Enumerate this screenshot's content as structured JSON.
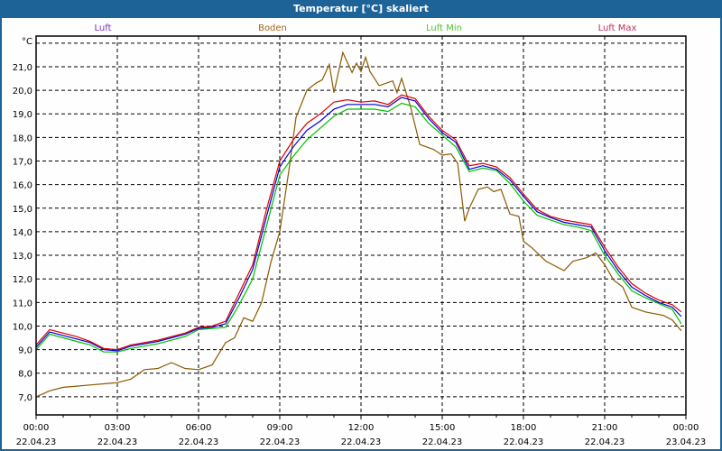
{
  "window": {
    "title": "Temperatur [°C] skaliert"
  },
  "chart_data": {
    "type": "line",
    "title": "Temperatur [°C] skaliert",
    "ylabel": "°C",
    "xlabel": "",
    "ylim": [
      6.23,
      22.3
    ],
    "xlim_hours": [
      0,
      24
    ],
    "grid": true,
    "legend_position": "top",
    "yticks": [
      7,
      8,
      9,
      10,
      11,
      12,
      13,
      14,
      15,
      16,
      17,
      18,
      19,
      20,
      21,
      22
    ],
    "ytick_labels": [
      "7,0",
      "8,0",
      "9,0",
      "10,0",
      "11,0",
      "12,0",
      "13,0",
      "14,0",
      "15,0",
      "16,0",
      "17,0",
      "18,0",
      "19,0",
      "20,0",
      "21,0",
      ""
    ],
    "xticks": [
      {
        "hour": 0,
        "time": "00:00",
        "date": "22.04.23"
      },
      {
        "hour": 3,
        "time": "03:00",
        "date": "22.04.23"
      },
      {
        "hour": 6,
        "time": "06:00",
        "date": "22.04.23"
      },
      {
        "hour": 9,
        "time": "09:00",
        "date": "22.04.23"
      },
      {
        "hour": 12,
        "time": "12:00",
        "date": "22.04.23"
      },
      {
        "hour": 15,
        "time": "15:00",
        "date": "22.04.23"
      },
      {
        "hour": 18,
        "time": "18:00",
        "date": "22.04.23"
      },
      {
        "hour": 21,
        "time": "21:00",
        "date": "22.04.23"
      },
      {
        "hour": 24,
        "time": "00:00",
        "date": "23.04.23"
      }
    ],
    "x_hours": [
      0,
      0.5,
      1,
      1.5,
      2,
      2.5,
      3,
      3.5,
      4,
      4.5,
      5,
      5.5,
      6,
      6.5,
      7,
      7.5,
      8,
      8.5,
      9,
      9.5,
      10,
      10.5,
      11,
      11.5,
      12,
      12.5,
      13,
      13.5,
      14,
      14.5,
      15,
      15.5,
      16,
      16.5,
      17,
      17.5,
      18,
      18.5,
      19,
      19.5,
      20,
      20.5,
      21,
      21.5,
      22,
      22.5,
      23,
      23.5,
      23.83
    ],
    "series": [
      {
        "name": "Luft",
        "color": "#0000e0",
        "values": [
          9.1,
          9.75,
          9.6,
          9.45,
          9.3,
          9.0,
          8.95,
          9.15,
          9.25,
          9.35,
          9.5,
          9.65,
          9.9,
          9.95,
          10.1,
          11.2,
          12.4,
          14.6,
          16.75,
          17.6,
          18.3,
          18.7,
          19.2,
          19.4,
          19.4,
          19.4,
          19.3,
          19.7,
          19.55,
          18.8,
          18.2,
          17.8,
          16.65,
          16.8,
          16.65,
          16.2,
          15.5,
          14.85,
          14.6,
          14.4,
          14.3,
          14.2,
          13.2,
          12.35,
          11.65,
          11.3,
          11.0,
          10.8,
          10.4
        ]
      },
      {
        "name": "Luft Min",
        "color": "#00c000",
        "values": [
          9.0,
          9.65,
          9.5,
          9.35,
          9.2,
          8.9,
          8.9,
          9.05,
          9.15,
          9.25,
          9.4,
          9.55,
          9.85,
          9.9,
          9.95,
          10.9,
          12.0,
          14.2,
          16.4,
          17.2,
          17.9,
          18.4,
          18.9,
          19.2,
          19.2,
          19.2,
          19.1,
          19.45,
          19.3,
          18.6,
          18.1,
          17.6,
          16.55,
          16.7,
          16.6,
          16.05,
          15.3,
          14.7,
          14.5,
          14.3,
          14.2,
          14.05,
          13.0,
          12.2,
          11.5,
          11.2,
          10.95,
          10.7,
          10.1
        ]
      },
      {
        "name": "Luft Max",
        "color": "#e00000",
        "values": [
          9.2,
          9.85,
          9.7,
          9.55,
          9.35,
          9.05,
          9.0,
          9.2,
          9.3,
          9.4,
          9.55,
          9.7,
          9.95,
          10.0,
          10.2,
          11.4,
          12.6,
          14.9,
          17.0,
          17.9,
          18.6,
          19.0,
          19.5,
          19.6,
          19.5,
          19.55,
          19.4,
          19.8,
          19.65,
          18.9,
          18.3,
          17.9,
          16.8,
          16.9,
          16.75,
          16.3,
          15.6,
          14.95,
          14.65,
          14.5,
          14.4,
          14.3,
          13.35,
          12.5,
          11.8,
          11.4,
          11.1,
          10.9,
          10.6
        ]
      },
      {
        "name": "Boden",
        "color": "#8b5a00",
        "x_hours": [
          0,
          0.5,
          1,
          1.5,
          2,
          2.5,
          3,
          3.5,
          4,
          4.5,
          5,
          5.5,
          6,
          6.5,
          7,
          7.33,
          7.67,
          8,
          8.33,
          8.67,
          9,
          9.33,
          9.6,
          10,
          10.33,
          10.57,
          10.83,
          11,
          11.33,
          11.67,
          11.83,
          12,
          12.17,
          12.33,
          12.67,
          13.17,
          13.33,
          13.5,
          13.83,
          14.17,
          14.67,
          15,
          15.33,
          15.57,
          15.83,
          16,
          16.33,
          16.67,
          16.9,
          17.17,
          17.5,
          17.83,
          18,
          18.33,
          18.83,
          19.5,
          19.83,
          20.33,
          20.67,
          21,
          21.33,
          21.67,
          22,
          22.5,
          23.17,
          23.5,
          23.83
        ],
        "values": [
          7.0,
          7.25,
          7.4,
          7.45,
          7.5,
          7.55,
          7.6,
          7.75,
          8.15,
          8.2,
          8.45,
          8.2,
          8.15,
          8.35,
          9.3,
          9.5,
          10.35,
          10.2,
          11.0,
          12.7,
          14.0,
          16.55,
          18.85,
          20.0,
          20.3,
          20.45,
          21.1,
          19.9,
          21.6,
          20.75,
          21.15,
          20.8,
          21.4,
          20.8,
          20.2,
          20.4,
          19.9,
          20.5,
          19.3,
          17.7,
          17.5,
          17.25,
          17.3,
          16.9,
          14.45,
          15.0,
          15.8,
          15.9,
          15.7,
          15.8,
          14.75,
          14.65,
          13.6,
          13.3,
          12.75,
          12.35,
          12.75,
          12.9,
          13.1,
          12.6,
          11.95,
          11.65,
          10.8,
          10.6,
          10.45,
          10.25,
          9.8
        ]
      }
    ],
    "legend": [
      {
        "name": "Luft",
        "color": "#7a2fc0"
      },
      {
        "name": "Boden",
        "color": "#a8641a"
      },
      {
        "name": "Luft Min",
        "color": "#58c030"
      },
      {
        "name": "Luft Max",
        "color": "#c03060"
      }
    ]
  }
}
